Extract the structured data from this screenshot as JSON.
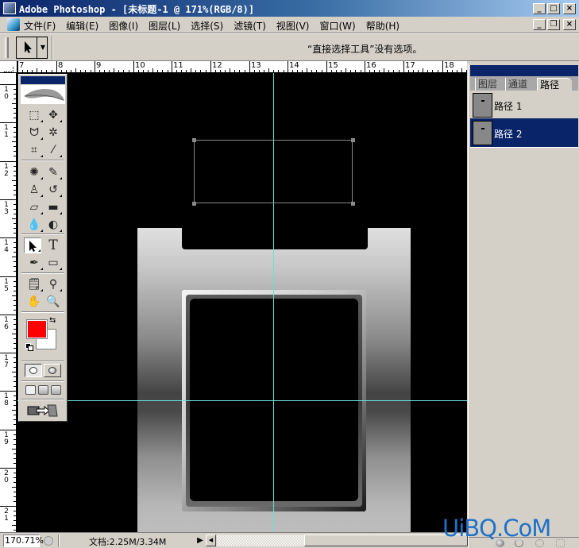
{
  "window": {
    "title": "Adobe Photoshop - [未标题-1 @ 171%(RGB/8)]",
    "buttons": {
      "minimize": "_",
      "maximize": "□",
      "close": "×"
    },
    "doc_buttons": {
      "minimize": "_",
      "restore": "❐",
      "close": "×"
    }
  },
  "menu": {
    "items": [
      "文件(F)",
      "编辑(E)",
      "图像(I)",
      "图层(L)",
      "选择(S)",
      "滤镜(T)",
      "视图(V)",
      "窗口(W)",
      "帮助(H)"
    ]
  },
  "options_bar": {
    "tool_icon": "direct-selection-arrow",
    "tool_glyph": "➤",
    "dropdown_glyph": "▼",
    "message": "“直接选择工具”没有选项。"
  },
  "rulers": {
    "horizontal_labels": [
      "7",
      "8",
      "9",
      "10",
      "11",
      "12",
      "13",
      "14",
      "15",
      "16",
      "17",
      "18"
    ],
    "vertical_labels": [
      "10",
      "11",
      "12",
      "13",
      "14",
      "15",
      "16",
      "17",
      "18",
      "19",
      "20",
      "21"
    ]
  },
  "toolbox": {
    "tools": [
      {
        "name": "marquee-tool",
        "glyph": "⬚"
      },
      {
        "name": "move-tool",
        "glyph": "✥"
      },
      {
        "name": "lasso-tool",
        "glyph": "ᗢ"
      },
      {
        "name": "magic-wand-tool",
        "glyph": "✲"
      },
      {
        "name": "crop-tool",
        "glyph": "⌗"
      },
      {
        "name": "slice-tool",
        "glyph": "⁄"
      },
      {
        "name": "healing-brush-tool",
        "glyph": "✺"
      },
      {
        "name": "brush-tool",
        "glyph": "✎"
      },
      {
        "name": "clone-stamp-tool",
        "glyph": "♙"
      },
      {
        "name": "history-brush-tool",
        "glyph": "↺"
      },
      {
        "name": "eraser-tool",
        "glyph": "▱"
      },
      {
        "name": "gradient-tool",
        "glyph": "▬"
      },
      {
        "name": "blur-tool",
        "glyph": "💧"
      },
      {
        "name": "dodge-tool",
        "glyph": "◐"
      },
      {
        "name": "direct-selection-tool",
        "glyph": "➤"
      },
      {
        "name": "type-tool",
        "glyph": "T"
      },
      {
        "name": "pen-tool",
        "glyph": "✒"
      },
      {
        "name": "rectangle-tool",
        "glyph": "▭"
      },
      {
        "name": "notes-tool",
        "glyph": "🗒"
      },
      {
        "name": "eyedropper-tool",
        "glyph": "⚲"
      },
      {
        "name": "hand-tool",
        "glyph": "✋"
      },
      {
        "name": "zoom-tool",
        "glyph": "🔍"
      }
    ],
    "active_tool": "direct-selection-tool",
    "foreground_color": "#ff0000",
    "background_color": "#ffffff",
    "swap_glyph": "⇆",
    "jump_glyph": "⇨"
  },
  "panel": {
    "tabs": [
      "图层",
      "通道",
      "路径"
    ],
    "active_tab": "路径",
    "paths": [
      {
        "name": "路径 1",
        "selected": false
      },
      {
        "name": "路径 2",
        "selected": true
      }
    ]
  },
  "status": {
    "zoom": "170.71%",
    "doc_info": "文档:2.25M/3.34M",
    "arrow_glyph": "▶",
    "scroll_left_glyph": "◀"
  },
  "watermark": "UiBQ.CoM",
  "colors": {
    "titlebar_start": "#0a246a",
    "titlebar_end": "#a6caf0",
    "selection": "#0a246a",
    "guide": "#66e0d8",
    "watermark": "#1e72c8"
  }
}
